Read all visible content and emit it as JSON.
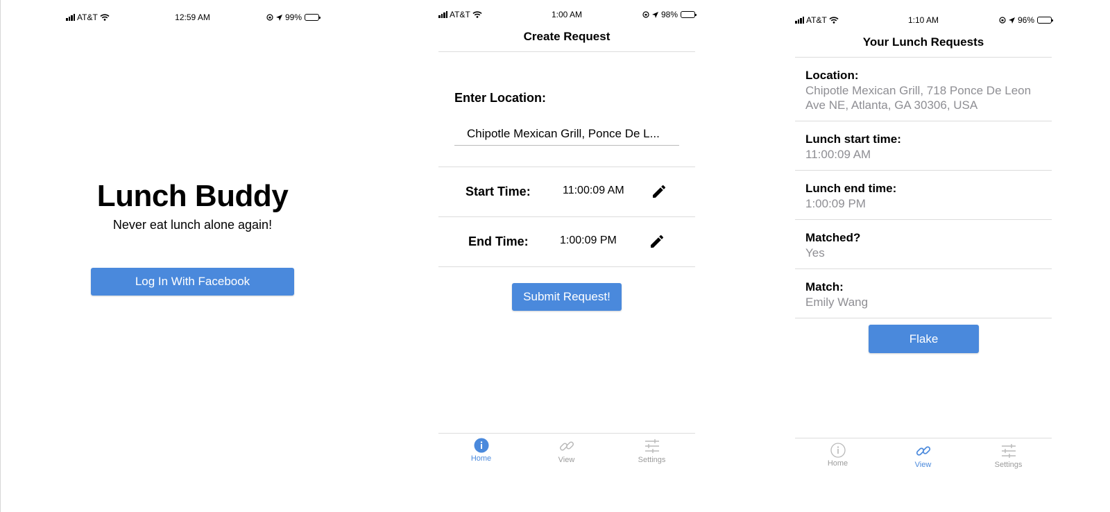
{
  "screen_login": {
    "status_bar": {
      "carrier": "AT&T",
      "time": "12:59 AM",
      "battery": "99%",
      "battery_level": 0.99
    },
    "app_title": "Lunch Buddy",
    "tagline": "Never eat lunch alone again!",
    "login_button": "Log In With Facebook",
    "colors": {
      "button": "#4a89dc"
    }
  },
  "screen_create": {
    "status_bar": {
      "carrier": "AT&T",
      "time": "1:00 AM",
      "battery": "98%",
      "battery_level": 0.98
    },
    "title": "Create Request",
    "location_label": "Enter Location:",
    "location_value": "Chipotle Mexican Grill, Ponce De L...",
    "start_label": "Start Time:",
    "start_value": "11:00:09 AM",
    "end_label": "End Time:",
    "end_value": "1:00:09 PM",
    "submit_button": "Submit Request!",
    "tabs": [
      {
        "label": "Home",
        "icon": "info-circle-icon",
        "active": true
      },
      {
        "label": "View",
        "icon": "link-icon",
        "active": false
      },
      {
        "label": "Settings",
        "icon": "sliders-icon",
        "active": false
      }
    ]
  },
  "screen_requests": {
    "status_bar": {
      "carrier": "AT&T",
      "time": "1:10 AM",
      "battery": "96%",
      "battery_level": 0.96
    },
    "title": "Your Lunch Requests",
    "fields": [
      {
        "label": "Location:",
        "value": "Chipotle Mexican Grill, 718 Ponce De Leon Ave NE, Atlanta, GA 30306, USA"
      },
      {
        "label": "Lunch start time:",
        "value": "11:00:09 AM"
      },
      {
        "label": "Lunch end time:",
        "value": "1:00:09 PM"
      },
      {
        "label": "Matched?",
        "value": "Yes"
      },
      {
        "label": "Match:",
        "value": "Emily Wang"
      }
    ],
    "flake_button": "Flake",
    "tabs": [
      {
        "label": "Home",
        "icon": "info-circle-icon",
        "active": false
      },
      {
        "label": "View",
        "icon": "link-icon",
        "active": true
      },
      {
        "label": "Settings",
        "icon": "sliders-icon",
        "active": false
      }
    ]
  },
  "colors": {
    "accent": "#4a89dc",
    "inactive": "#9b9b9b",
    "secondary_text": "#8e8e93",
    "divider": "#dcdcdc"
  }
}
